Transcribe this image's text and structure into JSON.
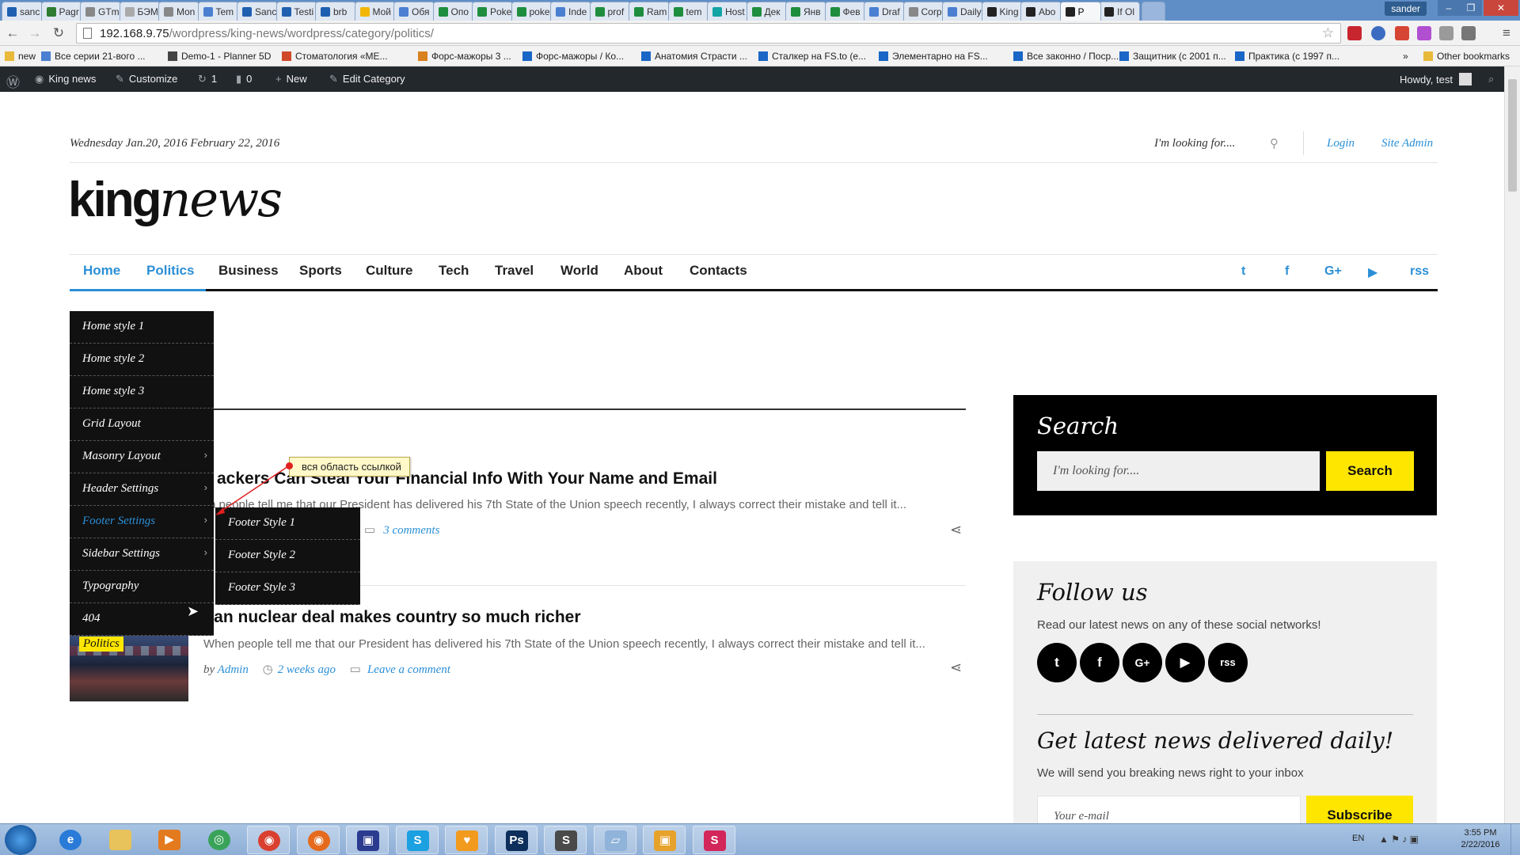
{
  "browser": {
    "tabs": [
      {
        "label": "sanc",
        "icon": "x"
      },
      {
        "label": "Pagr",
        "icon": "g"
      },
      {
        "label": "GTm",
        "icon": "gt"
      },
      {
        "label": "БЭМ",
        "icon": "h"
      },
      {
        "label": "Mon",
        "icon": "w"
      },
      {
        "label": "Tem",
        "icon": "doc"
      },
      {
        "label": "Sanc",
        "icon": "x"
      },
      {
        "label": "Testi",
        "icon": "x"
      },
      {
        "label": "brb",
        "icon": "x"
      },
      {
        "label": "Мой",
        "icon": "drive"
      },
      {
        "label": "Обя",
        "icon": "doc"
      },
      {
        "label": "Опо",
        "icon": "sheet"
      },
      {
        "label": "Poke",
        "icon": "sheet"
      },
      {
        "label": "poke",
        "icon": "sheet"
      },
      {
        "label": "Inde",
        "icon": "doc"
      },
      {
        "label": "prof",
        "icon": "sheet"
      },
      {
        "label": "Ram",
        "icon": "sheet"
      },
      {
        "label": "tem",
        "icon": "sheet"
      },
      {
        "label": "Host",
        "icon": "teal"
      },
      {
        "label": "Дек",
        "icon": "sheet"
      },
      {
        "label": "Янв",
        "icon": "sheet"
      },
      {
        "label": "Фев",
        "icon": "sheet"
      },
      {
        "label": "Draf",
        "icon": "doc"
      },
      {
        "label": "Corp",
        "icon": "q"
      },
      {
        "label": "Daily",
        "icon": "doc"
      },
      {
        "label": "King",
        "icon": "dark"
      },
      {
        "label": "Abo",
        "icon": "dark"
      },
      {
        "label": "P",
        "icon": "dark",
        "active": true
      },
      {
        "label": "If Ol",
        "icon": "dark"
      }
    ],
    "window_user": "sander",
    "url_host": "192.168.9.75",
    "url_path": "/wordpress/king-news/wordpress/category/politics/",
    "bookmarks": [
      "new",
      "Все серии 21-вого ...",
      "Demo-1 - Planner 5D",
      "Стоматология «МЕ...",
      "Форс-мажоры 3 ...",
      "Форс-мажоры / Ко...",
      "Анатомия Страсти ...",
      "Сталкер на FS.to (е...",
      "Элементарно на FS...",
      "Все законно / Поср...",
      "Защитник (с 2001 п...",
      "Практика (с 1997 п..."
    ],
    "other_bookmarks": "Other bookmarks"
  },
  "wpbar": {
    "site": "King news",
    "customize": "Customize",
    "updates": "1",
    "comments": "0",
    "new": "New",
    "edit": "Edit Category",
    "howdy": "Howdy, test"
  },
  "header": {
    "date": "Wednesday Jan.20, 2016 February 22, 2016",
    "search_placeholder": "I'm looking for....",
    "login": "Login",
    "site_admin": "Site Admin",
    "logo_bold": "king",
    "logo_italic": "news"
  },
  "nav": {
    "items": [
      "Home",
      "Politics",
      "Business",
      "Sports",
      "Culture",
      "Tech",
      "Travel",
      "World",
      "About",
      "Contacts"
    ],
    "active": [
      "Home",
      "Politics"
    ],
    "social_icons": [
      "twitter-icon",
      "facebook-icon",
      "google-plus-icon",
      "youtube-icon",
      "rss-icon"
    ],
    "social_glyphs": [
      "t",
      "f",
      "G+",
      "▶",
      "rss"
    ]
  },
  "dropdown": {
    "items": [
      {
        "label": "Home style 1",
        "arrow": false
      },
      {
        "label": "Home style 2",
        "arrow": false
      },
      {
        "label": "Home style 3",
        "arrow": false
      },
      {
        "label": "Grid Layout",
        "arrow": false
      },
      {
        "label": "Masonry Layout",
        "arrow": true
      },
      {
        "label": "Header Settings",
        "arrow": true
      },
      {
        "label": "Footer Settings",
        "arrow": true,
        "hover": true
      },
      {
        "label": "Sidebar Settings",
        "arrow": true
      },
      {
        "label": "Typography",
        "arrow": false
      },
      {
        "label": "404",
        "arrow": false
      }
    ],
    "submenu": [
      "Footer Style 1",
      "Footer Style 2",
      "Footer Style 3"
    ]
  },
  "annotation": {
    "text": "вся область ссылкой"
  },
  "posts": [
    {
      "title": "ackers Can Steal Your Financial Info With Your Name and Email",
      "excerpt": "n people tell me that our President has delivered his 7th State of the Union speech recently, I always correct their mistake and tell it...",
      "comments": "3 comments"
    },
    {
      "title": "ran nuclear deal makes country so much richer",
      "excerpt": "When people tell me that our President has delivered his 7th State of the Union speech recently, I always correct their mistake and tell it...",
      "by": "by",
      "author": "Admin",
      "time": "2 weeks ago",
      "comments": "Leave a comment",
      "category": "Politics"
    }
  ],
  "sidebar": {
    "search_title": "Search",
    "search_placeholder": "I'm looking for....",
    "search_button": "Search",
    "follow_title": "Follow us",
    "follow_text": "Read our latest news on any of these social networks!",
    "news_title": "Get latest news delivered daily!",
    "news_text": "We will send you breaking news right to your inbox",
    "email_placeholder": "Your e-mail",
    "subscribe": "Subscribe"
  },
  "taskbar": {
    "lang": "EN",
    "time": "3:55 PM",
    "date": "2/22/2016",
    "apps": [
      "ie",
      "explorer",
      "media",
      "network",
      "chrome",
      "firefox",
      "save",
      "skype",
      "ilovepdf",
      "photoshop",
      "sublime",
      "paint",
      "viewer",
      "skitch"
    ]
  },
  "colors": {
    "accent": "#2b8fd6",
    "yellow": "#ffe600",
    "dark": "#111111",
    "wpbar": "#23282d"
  }
}
